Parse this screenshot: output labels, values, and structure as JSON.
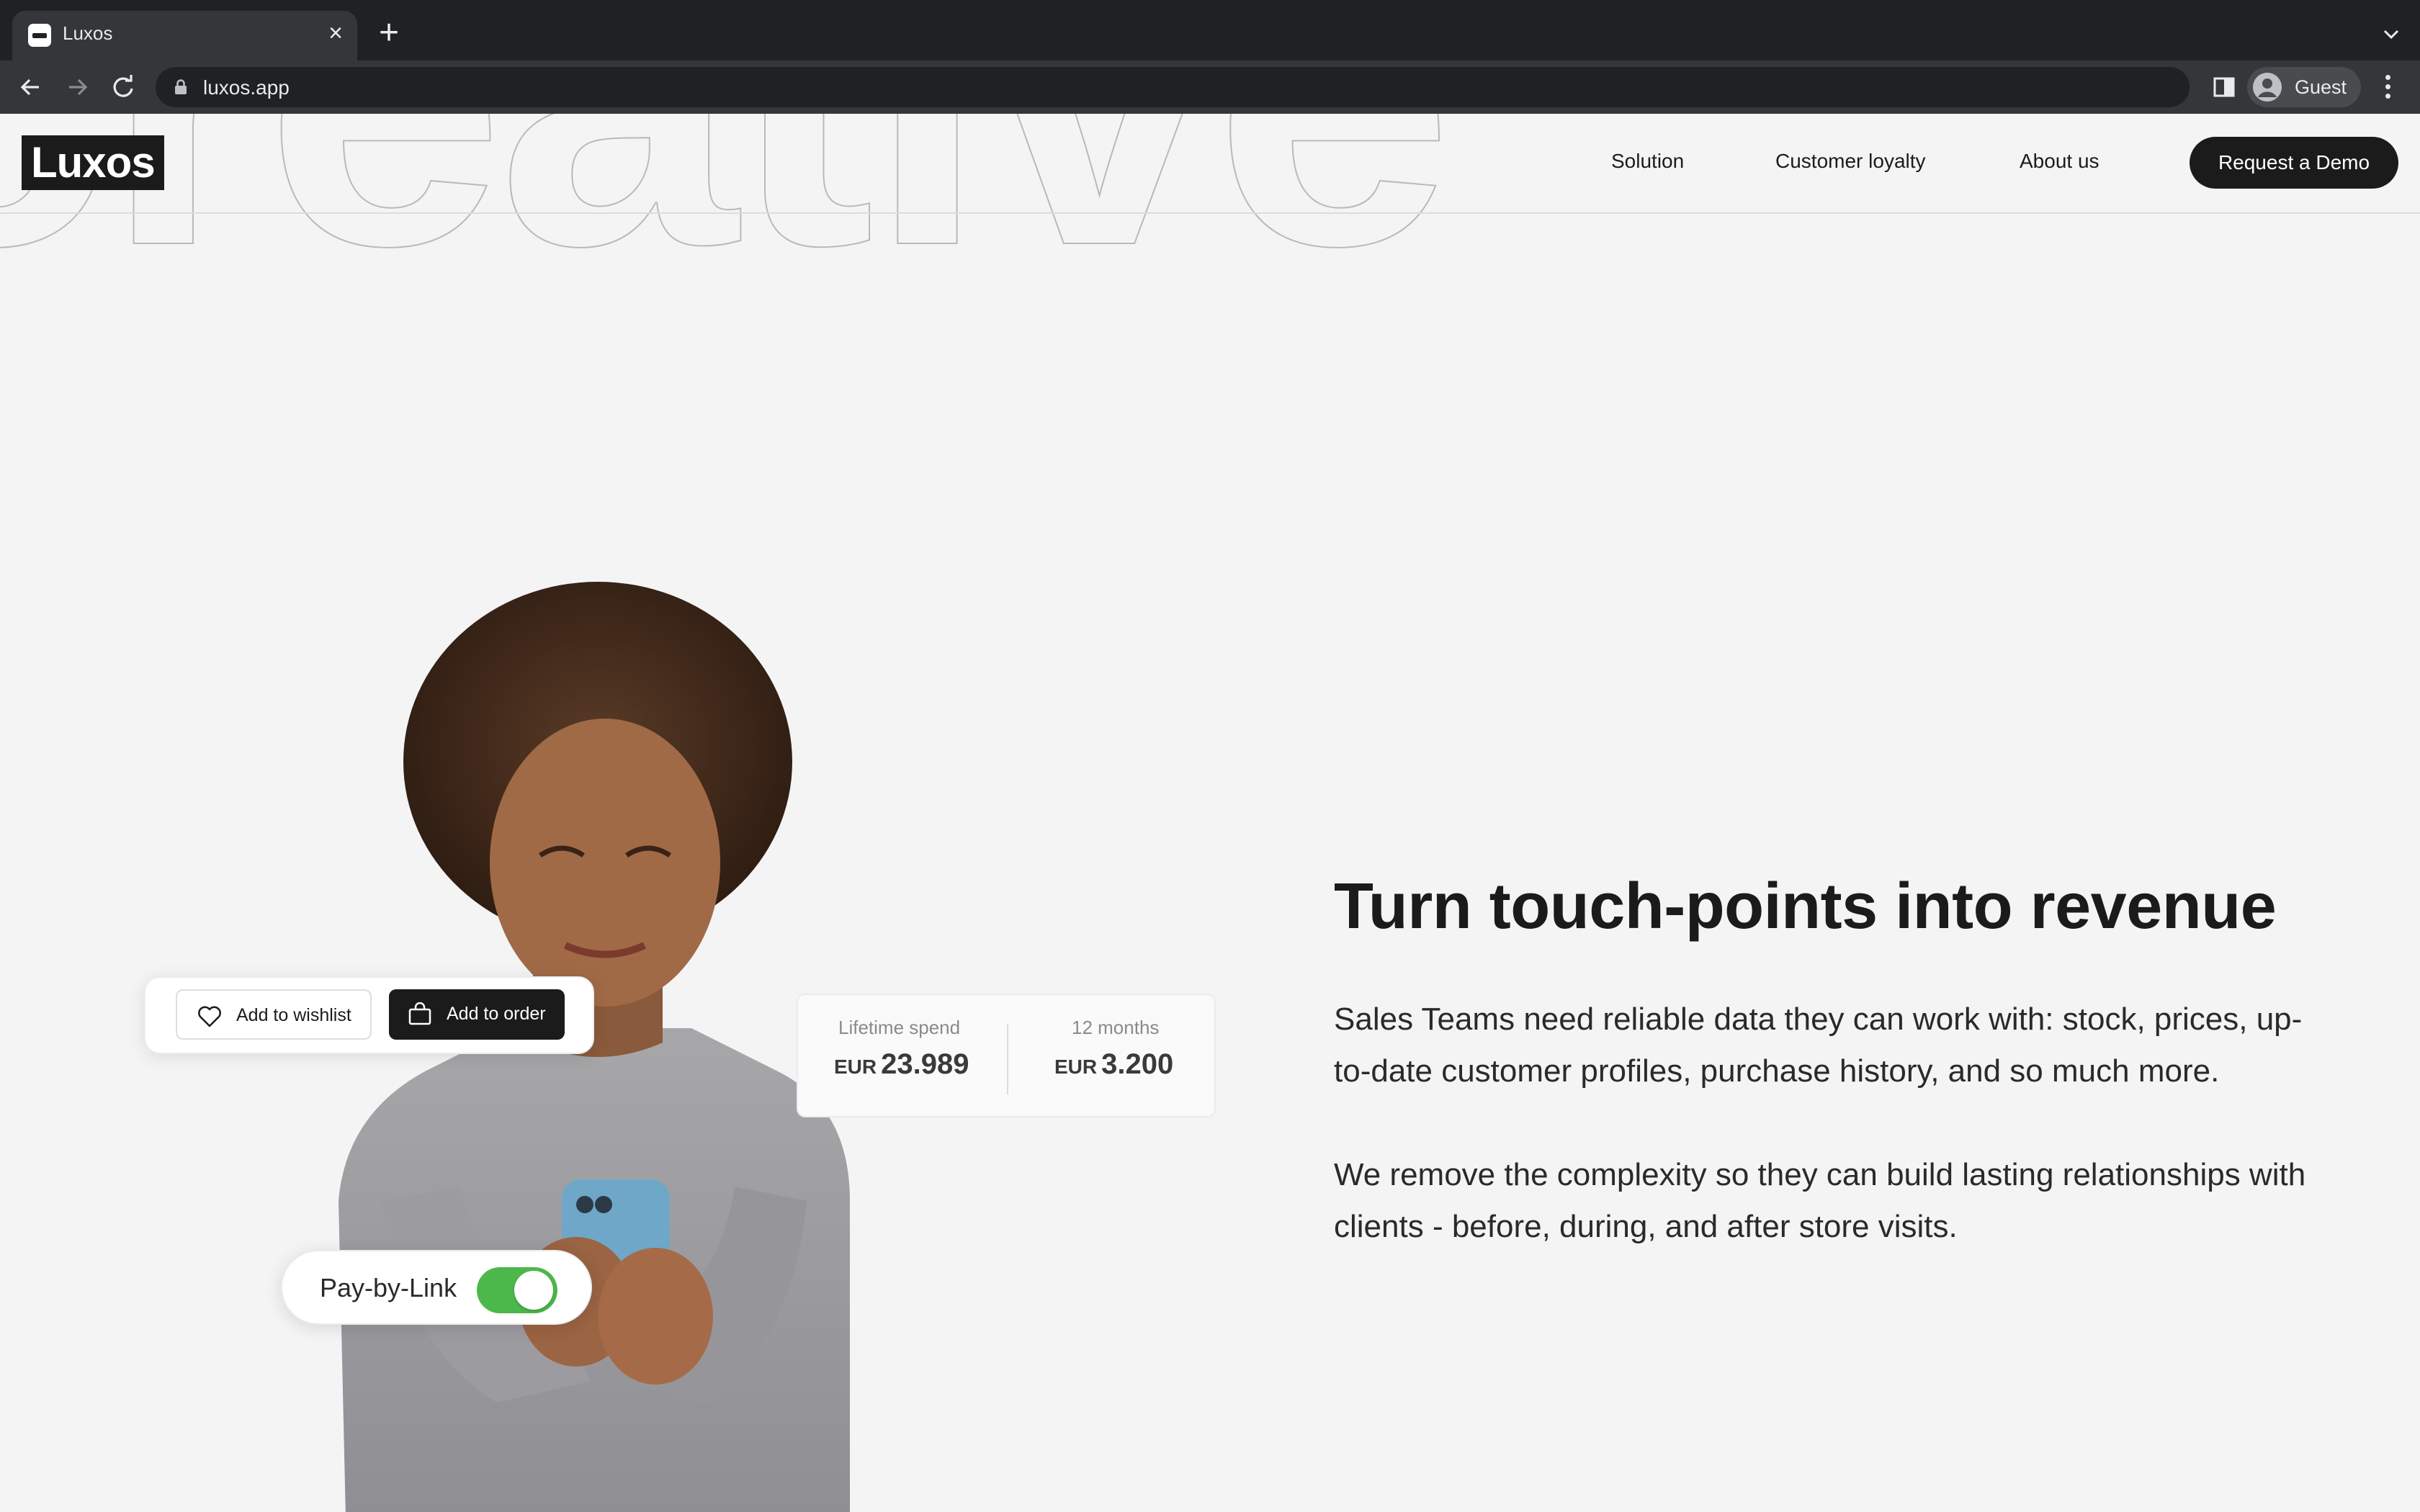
{
  "browser": {
    "tab_title": "Luxos",
    "url": "luxos.app",
    "profile_name": "Guest"
  },
  "site": {
    "logo": "Luxos",
    "nav": [
      {
        "label": "Solution"
      },
      {
        "label": "Customer loyalty"
      },
      {
        "label": "About us"
      }
    ],
    "cta_label": "Request a Demo",
    "background_word": "creative"
  },
  "hero": {
    "title": "Turn touch-points into revenue",
    "paragraph_1": "Sales Teams need reliable data they can work with: stock, prices, up-to-date customer profiles, purchase history, and so much more.",
    "paragraph_2": "We remove the complexity so they can build lasting relationships with clients - before, during, and after store visits."
  },
  "cards": {
    "wishlist_label": "Add to wishlist",
    "order_label": "Add to order",
    "lifetime_label": "Lifetime spend",
    "lifetime_currency": "EUR",
    "lifetime_value": "23.989",
    "months_label": "12 months",
    "months_currency": "EUR",
    "months_value": "3.200",
    "pay_label": "Pay-by-Link",
    "pay_toggle_on": true
  },
  "colors": {
    "accent_dark": "#1b1b1b",
    "toggle_green": "#4cb84c",
    "page_bg": "#f4f4f5"
  }
}
